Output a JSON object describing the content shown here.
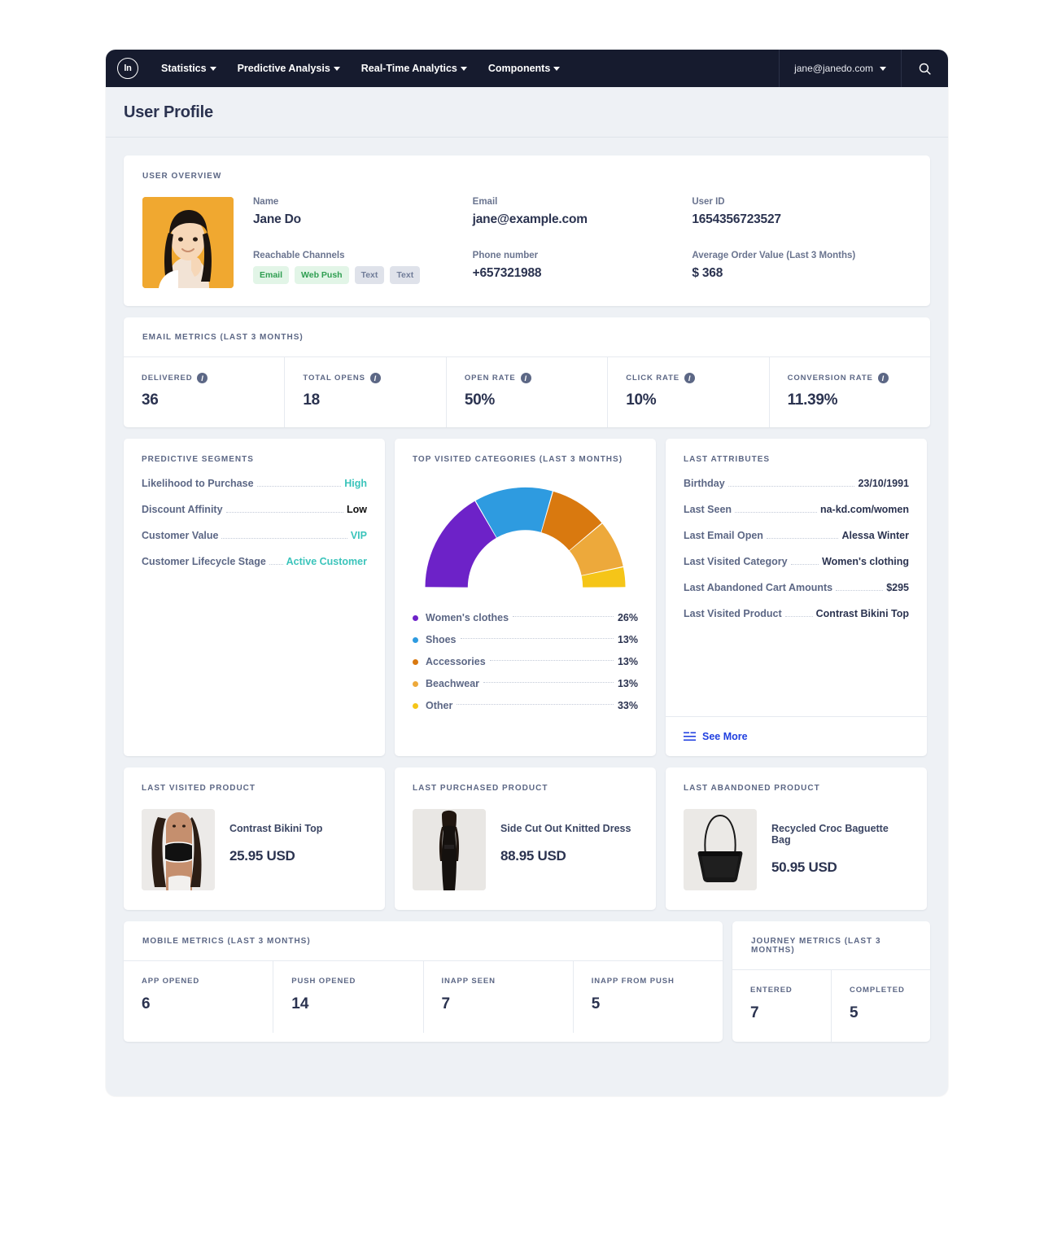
{
  "nav": {
    "logo_text": "ln",
    "items": [
      {
        "label": "Statistics",
        "has_caret": true
      },
      {
        "label": "Predictive Analysis",
        "has_caret": true
      },
      {
        "label": "Real-Time Analytics",
        "has_caret": true
      },
      {
        "label": "Components",
        "has_caret": true
      }
    ],
    "user_email": "jane@janedo.com"
  },
  "page": {
    "title": "User Profile"
  },
  "overview": {
    "title": "USER OVERVIEW",
    "name_label": "Name",
    "name_value": "Jane Do",
    "email_label": "Email",
    "email_value": "jane@example.com",
    "userid_label": "User ID",
    "userid_value": "1654356723527",
    "channels_label": "Reachable Channels",
    "channels": [
      {
        "label": "Email",
        "active": true
      },
      {
        "label": "Web Push",
        "active": true
      },
      {
        "label": "Text",
        "active": false
      },
      {
        "label": "Text",
        "active": false
      }
    ],
    "phone_label": "Phone number",
    "phone_value": "+657321988",
    "aov_label": "Average Order Value (Last 3 Months)",
    "aov_value": "$ 368"
  },
  "email_metrics": {
    "title": "EMAIL METRICS (LAST 3 MONTHS)",
    "cells": [
      {
        "label": "DELIVERED",
        "value": "36"
      },
      {
        "label": "TOTAL OPENS",
        "value": "18"
      },
      {
        "label": "OPEN RATE",
        "value": "50%"
      },
      {
        "label": "CLICK RATE",
        "value": "10%"
      },
      {
        "label": "CONVERSION RATE",
        "value": "11.39%"
      }
    ]
  },
  "predictive_segments": {
    "title": "PREDICTIVE SEGMENTS",
    "rows": [
      {
        "key": "Likelihood to Purchase",
        "value": "High",
        "style": "teal"
      },
      {
        "key": "Discount Affinity",
        "value": "Low",
        "style": "dark"
      },
      {
        "key": "Customer Value",
        "value": "VIP",
        "style": "teal"
      },
      {
        "key": "Customer Lifecycle Stage",
        "value": "Active Customer",
        "style": "teal"
      }
    ]
  },
  "chart_data": {
    "type": "pie",
    "title": "TOP VISITED CATEGORIES (LAST 3 MONTHS)",
    "subtitle": "",
    "variant": "half-donut",
    "legend_position": "bottom",
    "categories": [
      "Women's clothes",
      "Shoes",
      "Accessories",
      "Beachwear",
      "Other"
    ],
    "values": [
      26,
      13,
      13,
      13,
      33
    ],
    "value_labels": [
      "26%",
      "13%",
      "13%",
      "13%",
      "33%"
    ],
    "colors": [
      "#6d22c8",
      "#2e9be0",
      "#d9790f",
      "#eda93b",
      "#f5c518"
    ],
    "arc_sweeps_deg": [
      60,
      46,
      34,
      28,
      12
    ],
    "unit": "%",
    "xlabel": "",
    "ylabel": ""
  },
  "last_attributes": {
    "title": "LAST ATTRIBUTES",
    "rows": [
      {
        "key": "Birthday",
        "value": "23/10/1991"
      },
      {
        "key": "Last Seen",
        "value": "na-kd.com/women"
      },
      {
        "key": "Last Email Open",
        "value": "Alessa Winter"
      },
      {
        "key": "Last Visited Category",
        "value": "Women's clothing"
      },
      {
        "key": "Last Abandoned Cart Amounts",
        "value": "$295"
      },
      {
        "key": "Last Visited Product",
        "value": "Contrast Bikini Top"
      }
    ],
    "see_more_label": "See More"
  },
  "products": [
    {
      "title": "LAST VISITED PRODUCT",
      "name": "Contrast Bikini Top",
      "price": "25.95 USD",
      "thumb": "bikini"
    },
    {
      "title": "LAST PURCHASED PRODUCT",
      "name": "Side Cut Out Knitted Dress",
      "price": "88.95 USD",
      "thumb": "dress"
    },
    {
      "title": "LAST ABANDONED PRODUCT",
      "name": "Recycled Croc Baguette Bag",
      "price": "50.95 USD",
      "thumb": "bag"
    }
  ],
  "mobile_metrics": {
    "title": "MOBILE METRICS (LAST 3 MONTHS)",
    "cells": [
      {
        "label": "APP OPENED",
        "value": "6"
      },
      {
        "label": "PUSH OPENED",
        "value": "14"
      },
      {
        "label": "INAPP SEEN",
        "value": "7"
      },
      {
        "label": "INAPP FROM PUSH",
        "value": "5"
      }
    ]
  },
  "journey_metrics": {
    "title": "JOURNEY METRICS (LAST 3 MONTHS)",
    "cells": [
      {
        "label": "ENTERED",
        "value": "7"
      },
      {
        "label": "COMPLETED",
        "value": "5"
      }
    ]
  },
  "theme": {
    "nav_bg": "#161b2e",
    "page_bg": "#eef1f5",
    "accent_blue": "#2140e0",
    "accent_teal": "#3bc4bb",
    "text_dark": "#2b3350",
    "text_muted": "#5c6785"
  }
}
